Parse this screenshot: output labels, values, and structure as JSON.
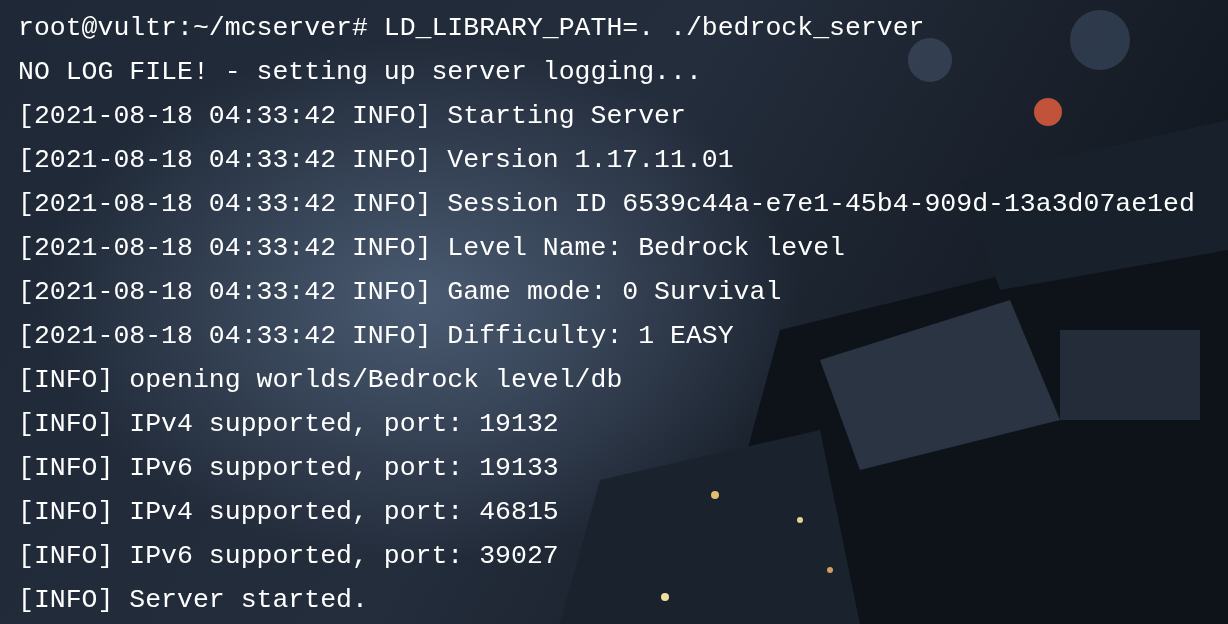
{
  "terminal": {
    "lines": [
      "root@vultr:~/mcserver# LD_LIBRARY_PATH=. ./bedrock_server",
      "NO LOG FILE! - setting up server logging...",
      "[2021-08-18 04:33:42 INFO] Starting Server",
      "[2021-08-18 04:33:42 INFO] Version 1.17.11.01",
      "[2021-08-18 04:33:42 INFO] Session ID 6539c44a-e7e1-45b4-909d-13a3d07ae1ed",
      "[2021-08-18 04:33:42 INFO] Level Name: Bedrock level",
      "[2021-08-18 04:33:42 INFO] Game mode: 0 Survival",
      "[2021-08-18 04:33:42 INFO] Difficulty: 1 EASY",
      "[INFO] opening worlds/Bedrock level/db",
      "[INFO] IPv4 supported, port: 19132",
      "[INFO] IPv6 supported, port: 19133",
      "[INFO] IPv4 supported, port: 46815",
      "[INFO] IPv6 supported, port: 39027",
      "[INFO] Server started."
    ]
  }
}
